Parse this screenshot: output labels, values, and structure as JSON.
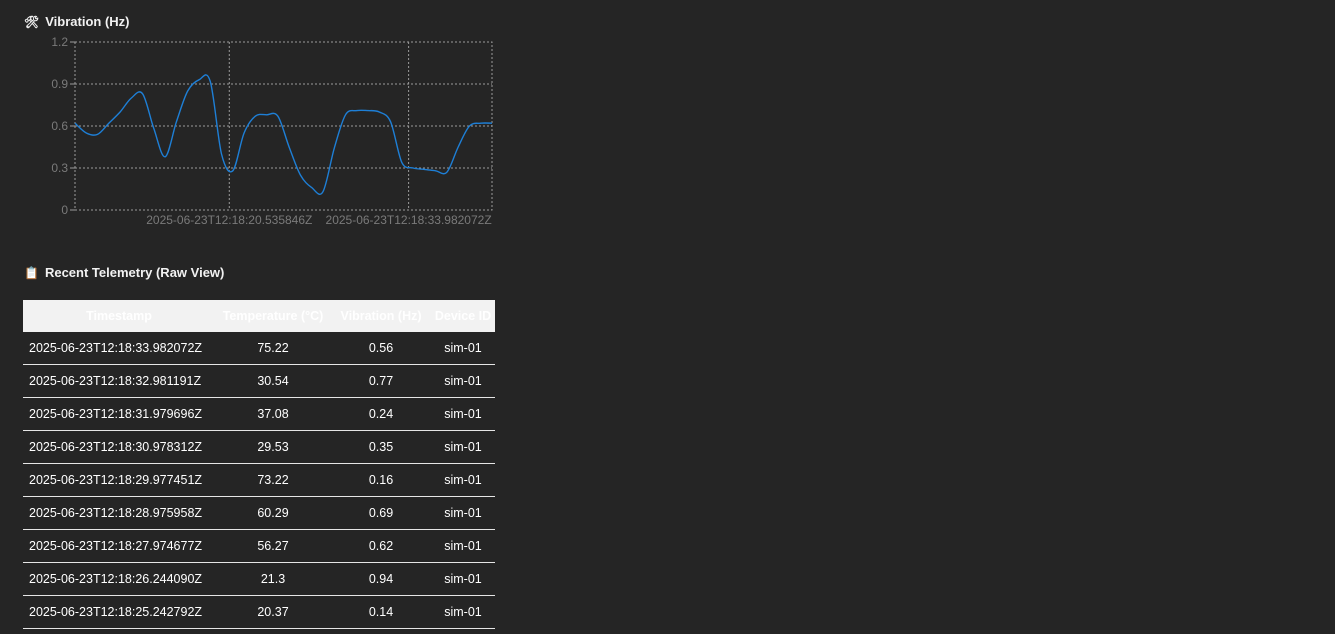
{
  "chart_section": {
    "icon": "🛠",
    "icon_name": "tools-icon",
    "title": "Vibration (Hz)"
  },
  "table_section": {
    "icon": "📋",
    "icon_name": "clipboard-icon",
    "title": "Recent Telemetry (Raw View)"
  },
  "colors": {
    "background": "#252525",
    "line": "#1e7fd6",
    "grid": "#9a9a9a",
    "header_bg": "#f2f2f2"
  },
  "chart_data": {
    "type": "line",
    "title": "Vibration (Hz)",
    "xlabel": "",
    "ylabel": "",
    "ylim": [
      0,
      1.2
    ],
    "yticks": [
      "0",
      "0.3",
      "0.6",
      "0.9",
      "1.2"
    ],
    "xticks": [
      "2025-06-23T12:18:20.535846Z",
      "2025-06-23T12:18:33.982072Z"
    ],
    "grid": true,
    "series": [
      {
        "values": [
          0.62,
          0.55,
          0.54,
          0.62,
          0.7,
          0.8,
          0.83,
          0.58,
          0.38,
          0.63,
          0.85,
          0.93,
          0.92,
          0.4,
          0.28,
          0.55,
          0.67,
          0.68,
          0.67,
          0.45,
          0.25,
          0.16,
          0.13,
          0.44,
          0.68,
          0.71,
          0.71,
          0.7,
          0.63,
          0.34,
          0.3,
          0.29,
          0.28,
          0.27,
          0.45,
          0.6,
          0.62,
          0.62
        ]
      }
    ]
  },
  "table": {
    "columns": [
      "Timestamp",
      "Temperature (°C)",
      "Vibration (Hz)",
      "Device ID"
    ],
    "rows": [
      [
        "2025-06-23T12:18:33.982072Z",
        "75.22",
        "0.56",
        "sim-01"
      ],
      [
        "2025-06-23T12:18:32.981191Z",
        "30.54",
        "0.77",
        "sim-01"
      ],
      [
        "2025-06-23T12:18:31.979696Z",
        "37.08",
        "0.24",
        "sim-01"
      ],
      [
        "2025-06-23T12:18:30.978312Z",
        "29.53",
        "0.35",
        "sim-01"
      ],
      [
        "2025-06-23T12:18:29.977451Z",
        "73.22",
        "0.16",
        "sim-01"
      ],
      [
        "2025-06-23T12:18:28.975958Z",
        "60.29",
        "0.69",
        "sim-01"
      ],
      [
        "2025-06-23T12:18:27.974677Z",
        "56.27",
        "0.62",
        "sim-01"
      ],
      [
        "2025-06-23T12:18:26.244090Z",
        "21.3",
        "0.94",
        "sim-01"
      ],
      [
        "2025-06-23T12:18:25.242792Z",
        "20.37",
        "0.14",
        "sim-01"
      ]
    ]
  }
}
